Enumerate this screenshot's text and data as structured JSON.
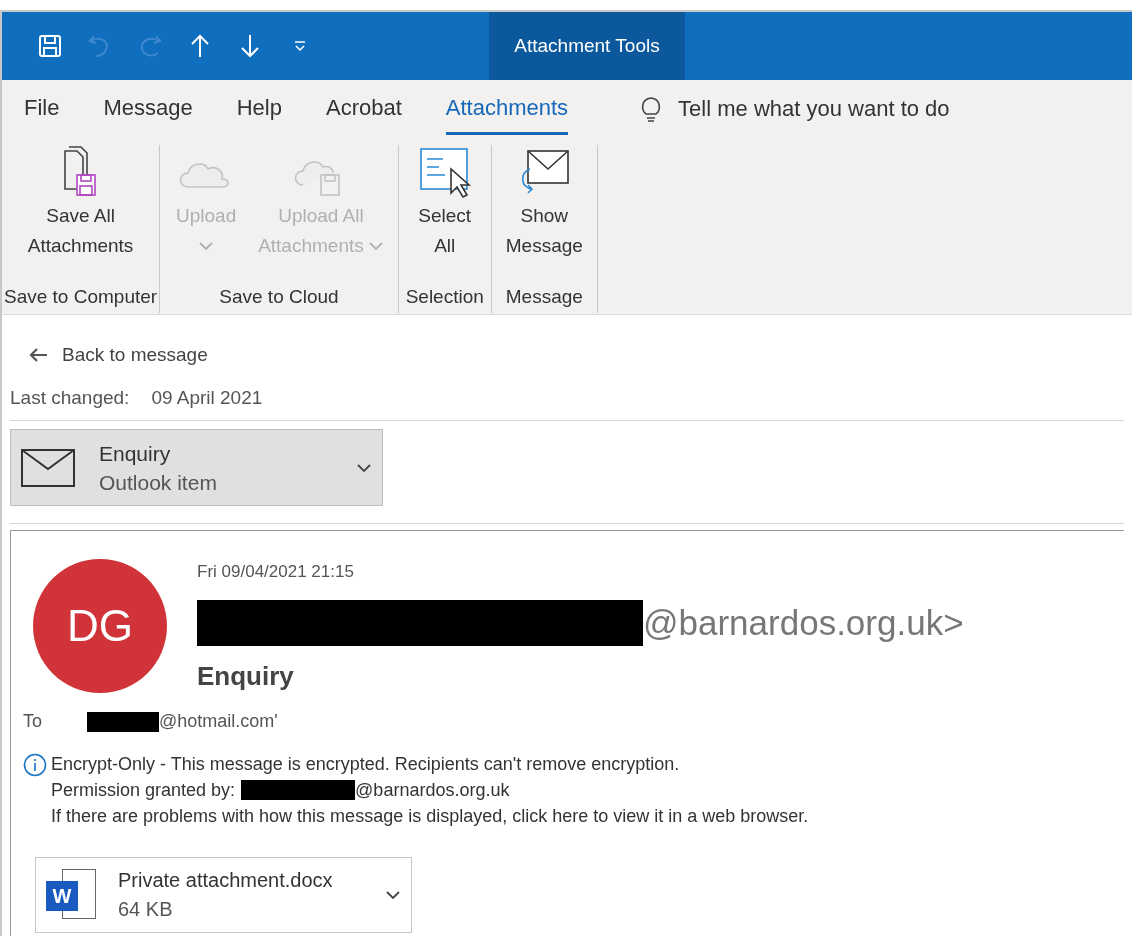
{
  "quick_access": [
    {
      "kind": "save",
      "disabled": false
    },
    {
      "kind": "undo",
      "disabled": true
    },
    {
      "kind": "redo",
      "disabled": true
    },
    {
      "kind": "up",
      "disabled": false
    },
    {
      "kind": "down",
      "disabled": false
    },
    {
      "kind": "customize",
      "disabled": false
    }
  ],
  "contextual_title": "Attachment Tools",
  "tabs": [
    {
      "label": "File",
      "selected": false
    },
    {
      "label": "Message",
      "selected": false
    },
    {
      "label": "Help",
      "selected": false
    },
    {
      "label": "Acrobat",
      "selected": false
    },
    {
      "label": "Attachments",
      "selected": true
    }
  ],
  "tell_me": "Tell me what you want to do",
  "ribbon_groups": [
    {
      "label": "Save to Computer",
      "buttons": [
        {
          "kind": "save",
          "lines": [
            "Save All",
            "Attachments"
          ],
          "disabled": false,
          "dropdown": false
        }
      ]
    },
    {
      "label": "Save to Cloud",
      "buttons": [
        {
          "kind": "upload",
          "lines": [
            "Upload"
          ],
          "disabled": true,
          "dropdown": true
        },
        {
          "kind": "uploadall",
          "lines": [
            "Upload All",
            "Attachments"
          ],
          "disabled": true,
          "dropdown": true
        }
      ]
    },
    {
      "label": "Selection",
      "buttons": [
        {
          "kind": "select",
          "lines": [
            "Select",
            "All"
          ],
          "disabled": false,
          "dropdown": false
        }
      ]
    },
    {
      "label": "Message",
      "buttons": [
        {
          "kind": "show",
          "lines": [
            "Show",
            "Message"
          ],
          "disabled": false,
          "dropdown": false
        }
      ]
    }
  ],
  "back_link": "Back to message",
  "last_changed": {
    "label": "Last changed:",
    "value": "09 April 2021"
  },
  "item_card": {
    "title": "Enquiry",
    "subtitle": "Outlook item"
  },
  "email": {
    "avatar_initials": "DG",
    "date": "Fri 09/04/2021 21:15",
    "sender": {
      "redacted": true,
      "suffix": "@barnardos.org.uk>"
    },
    "subject": "Enquiry",
    "to": {
      "label": "To",
      "redacted": true,
      "suffix": "@hotmail.com'"
    },
    "info_lines": [
      "Encrypt-Only - This message is encrypted. Recipients can't remove encryption.",
      "Permission granted by:",
      "If there are problems with how this message is displayed, click here to view it in a web browser."
    ],
    "permission": {
      "redacted": true,
      "suffix": "@barnardos.org.uk"
    },
    "attachment": {
      "icon_letter": "W",
      "name": "Private attachment.docx",
      "size": "64 KB"
    }
  }
}
